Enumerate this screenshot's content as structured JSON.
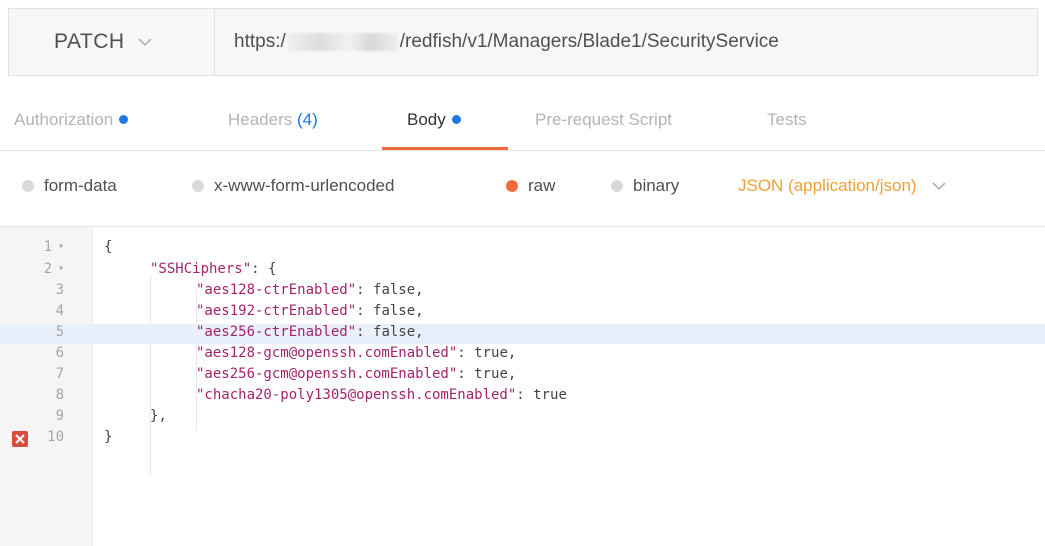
{
  "request": {
    "method": "PATCH",
    "url_prefix": "https:/",
    "url_suffix": "/redfish/v1/Managers/Blade1/SecurityService"
  },
  "tabs": [
    {
      "label": "Authorization",
      "has_dot": true,
      "active": false
    },
    {
      "label": "Headers",
      "count": "(4)",
      "active": false
    },
    {
      "label": "Body",
      "has_dot": true,
      "active": true
    },
    {
      "label": "Pre-request Script",
      "active": false
    },
    {
      "label": "Tests",
      "active": false
    }
  ],
  "body_modes": [
    {
      "label": "form-data",
      "selected": false
    },
    {
      "label": "x-www-form-urlencoded",
      "selected": false
    },
    {
      "label": "raw",
      "selected": true
    },
    {
      "label": "binary",
      "selected": false
    }
  ],
  "content_type": "JSON (application/json)",
  "editor": {
    "highlighted_line": 5,
    "error_line": 10,
    "lines": [
      {
        "n": "1",
        "fold": true,
        "text": "{"
      },
      {
        "n": "2",
        "fold": true,
        "key": "\"SSHCiphers\"",
        "rest": ": {"
      },
      {
        "n": "3",
        "key": "\"aes128-ctrEnabled\"",
        "rest": ": false,"
      },
      {
        "n": "4",
        "key": "\"aes192-ctrEnabled\"",
        "rest": ": false,"
      },
      {
        "n": "5",
        "key": "\"aes256-ctrEnabled\"",
        "rest": ": false,"
      },
      {
        "n": "6",
        "key": "\"aes128-gcm@openssh.comEnabled\"",
        "rest": ": true,"
      },
      {
        "n": "7",
        "key": "\"aes256-gcm@openssh.comEnabled\"",
        "rest": ": true,"
      },
      {
        "n": "8",
        "key": "\"chacha20-poly1305@openssh.comEnabled\"",
        "rest": ": true"
      },
      {
        "n": "9",
        "text": "},"
      },
      {
        "n": "10",
        "text": "}"
      }
    ]
  },
  "colors": {
    "accent": "#f26b3a",
    "tab_dot": "#1e78e6",
    "json_string": "#a3246c",
    "content_type": "#f0a030"
  }
}
